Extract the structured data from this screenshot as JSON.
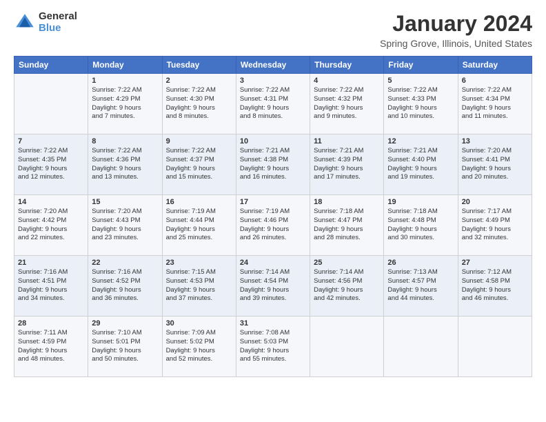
{
  "header": {
    "logo_line1": "General",
    "logo_line2": "Blue",
    "month": "January 2024",
    "location": "Spring Grove, Illinois, United States"
  },
  "days_of_week": [
    "Sunday",
    "Monday",
    "Tuesday",
    "Wednesday",
    "Thursday",
    "Friday",
    "Saturday"
  ],
  "weeks": [
    [
      {
        "day": "",
        "content": ""
      },
      {
        "day": "1",
        "content": "Sunrise: 7:22 AM\nSunset: 4:29 PM\nDaylight: 9 hours\nand 7 minutes."
      },
      {
        "day": "2",
        "content": "Sunrise: 7:22 AM\nSunset: 4:30 PM\nDaylight: 9 hours\nand 8 minutes."
      },
      {
        "day": "3",
        "content": "Sunrise: 7:22 AM\nSunset: 4:31 PM\nDaylight: 9 hours\nand 8 minutes."
      },
      {
        "day": "4",
        "content": "Sunrise: 7:22 AM\nSunset: 4:32 PM\nDaylight: 9 hours\nand 9 minutes."
      },
      {
        "day": "5",
        "content": "Sunrise: 7:22 AM\nSunset: 4:33 PM\nDaylight: 9 hours\nand 10 minutes."
      },
      {
        "day": "6",
        "content": "Sunrise: 7:22 AM\nSunset: 4:34 PM\nDaylight: 9 hours\nand 11 minutes."
      }
    ],
    [
      {
        "day": "7",
        "content": "Sunrise: 7:22 AM\nSunset: 4:35 PM\nDaylight: 9 hours\nand 12 minutes."
      },
      {
        "day": "8",
        "content": "Sunrise: 7:22 AM\nSunset: 4:36 PM\nDaylight: 9 hours\nand 13 minutes."
      },
      {
        "day": "9",
        "content": "Sunrise: 7:22 AM\nSunset: 4:37 PM\nDaylight: 9 hours\nand 15 minutes."
      },
      {
        "day": "10",
        "content": "Sunrise: 7:21 AM\nSunset: 4:38 PM\nDaylight: 9 hours\nand 16 minutes."
      },
      {
        "day": "11",
        "content": "Sunrise: 7:21 AM\nSunset: 4:39 PM\nDaylight: 9 hours\nand 17 minutes."
      },
      {
        "day": "12",
        "content": "Sunrise: 7:21 AM\nSunset: 4:40 PM\nDaylight: 9 hours\nand 19 minutes."
      },
      {
        "day": "13",
        "content": "Sunrise: 7:20 AM\nSunset: 4:41 PM\nDaylight: 9 hours\nand 20 minutes."
      }
    ],
    [
      {
        "day": "14",
        "content": "Sunrise: 7:20 AM\nSunset: 4:42 PM\nDaylight: 9 hours\nand 22 minutes."
      },
      {
        "day": "15",
        "content": "Sunrise: 7:20 AM\nSunset: 4:43 PM\nDaylight: 9 hours\nand 23 minutes."
      },
      {
        "day": "16",
        "content": "Sunrise: 7:19 AM\nSunset: 4:44 PM\nDaylight: 9 hours\nand 25 minutes."
      },
      {
        "day": "17",
        "content": "Sunrise: 7:19 AM\nSunset: 4:46 PM\nDaylight: 9 hours\nand 26 minutes."
      },
      {
        "day": "18",
        "content": "Sunrise: 7:18 AM\nSunset: 4:47 PM\nDaylight: 9 hours\nand 28 minutes."
      },
      {
        "day": "19",
        "content": "Sunrise: 7:18 AM\nSunset: 4:48 PM\nDaylight: 9 hours\nand 30 minutes."
      },
      {
        "day": "20",
        "content": "Sunrise: 7:17 AM\nSunset: 4:49 PM\nDaylight: 9 hours\nand 32 minutes."
      }
    ],
    [
      {
        "day": "21",
        "content": "Sunrise: 7:16 AM\nSunset: 4:51 PM\nDaylight: 9 hours\nand 34 minutes."
      },
      {
        "day": "22",
        "content": "Sunrise: 7:16 AM\nSunset: 4:52 PM\nDaylight: 9 hours\nand 36 minutes."
      },
      {
        "day": "23",
        "content": "Sunrise: 7:15 AM\nSunset: 4:53 PM\nDaylight: 9 hours\nand 37 minutes."
      },
      {
        "day": "24",
        "content": "Sunrise: 7:14 AM\nSunset: 4:54 PM\nDaylight: 9 hours\nand 39 minutes."
      },
      {
        "day": "25",
        "content": "Sunrise: 7:14 AM\nSunset: 4:56 PM\nDaylight: 9 hours\nand 42 minutes."
      },
      {
        "day": "26",
        "content": "Sunrise: 7:13 AM\nSunset: 4:57 PM\nDaylight: 9 hours\nand 44 minutes."
      },
      {
        "day": "27",
        "content": "Sunrise: 7:12 AM\nSunset: 4:58 PM\nDaylight: 9 hours\nand 46 minutes."
      }
    ],
    [
      {
        "day": "28",
        "content": "Sunrise: 7:11 AM\nSunset: 4:59 PM\nDaylight: 9 hours\nand 48 minutes."
      },
      {
        "day": "29",
        "content": "Sunrise: 7:10 AM\nSunset: 5:01 PM\nDaylight: 9 hours\nand 50 minutes."
      },
      {
        "day": "30",
        "content": "Sunrise: 7:09 AM\nSunset: 5:02 PM\nDaylight: 9 hours\nand 52 minutes."
      },
      {
        "day": "31",
        "content": "Sunrise: 7:08 AM\nSunset: 5:03 PM\nDaylight: 9 hours\nand 55 minutes."
      },
      {
        "day": "",
        "content": ""
      },
      {
        "day": "",
        "content": ""
      },
      {
        "day": "",
        "content": ""
      }
    ]
  ]
}
